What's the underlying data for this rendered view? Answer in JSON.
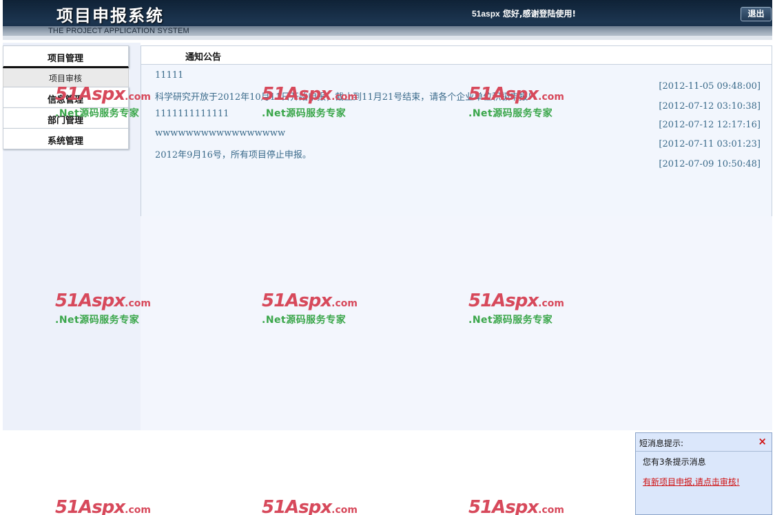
{
  "header": {
    "title_cn": "项目申报系统",
    "title_en": "THE PROJECT APPLICATION SYSTEM",
    "welcome_user": "51aspx",
    "welcome_text": " 您好,感谢登陆使用!",
    "logout_label": "退出"
  },
  "menu": {
    "groups": [
      {
        "label": "项目管理",
        "items": [
          {
            "label": "项目审核"
          }
        ]
      },
      {
        "label": "信息管理"
      },
      {
        "label": "部门管理"
      },
      {
        "label": "系统管理"
      }
    ]
  },
  "notice": {
    "title": "通知公告",
    "items": [
      {
        "text": "11111"
      },
      {
        "text": "科学研究开放于2012年10月11日开始申报，截止到11月21号结束，请各个企业单位积极申报!"
      },
      {
        "text": "1111111111111"
      },
      {
        "text": "wwwwwwwwwwwwwwwww"
      },
      {
        "text": "2012年9月16号，所有项目停止申报。"
      }
    ],
    "dates": [
      "[2012-11-05 09:48:00]",
      "[2012-07-12 03:10:38]",
      "[2012-07-12 12:17:16]",
      "[2012-07-11 03:01:23]",
      "[2012-07-09 10:50:48]"
    ]
  },
  "watermark": {
    "brand": "51Aspx",
    "suffix": ".com",
    "slogan": ".Net源码服务专家"
  },
  "popup": {
    "title": "短消息提示:",
    "close_icon": "×",
    "message": "您有3条提示消息",
    "link": "有新项目申报,请点击审核!"
  },
  "colors": {
    "header_bg": "#1c3550",
    "link_text": "#3a6a8a",
    "watermark_red": "#d7495b",
    "watermark_green": "#3aa64a",
    "alert_red": "#d01010"
  }
}
